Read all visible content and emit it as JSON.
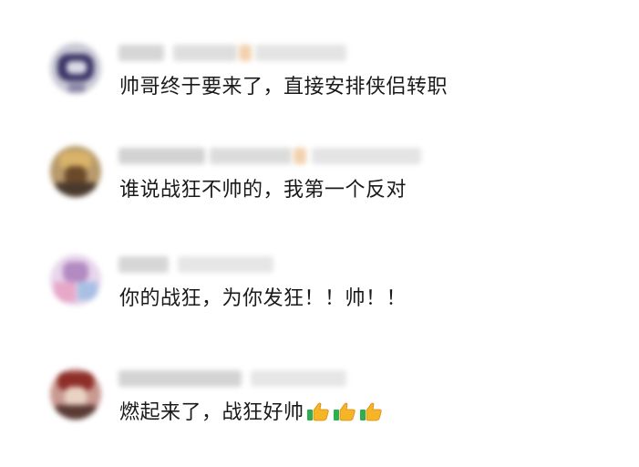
{
  "comments": [
    {
      "text": "帅哥终于要来了，直接安排侠侣转职",
      "emoji": []
    },
    {
      "text": "谁说战狂不帅的，我第一个反对",
      "emoji": []
    },
    {
      "text": "你的战狂，为你发狂！！帅！！",
      "emoji": []
    },
    {
      "text": "燃起来了，战狂好帅",
      "emoji": [
        "thumbs-up-icon",
        "thumbs-up-icon",
        "thumbs-up-icon"
      ]
    }
  ],
  "colors": {
    "text": "#1a1a1a",
    "meta_blur": "#dcdcdc",
    "meta_accent": "#f4d9b7",
    "background": "#ffffff"
  }
}
